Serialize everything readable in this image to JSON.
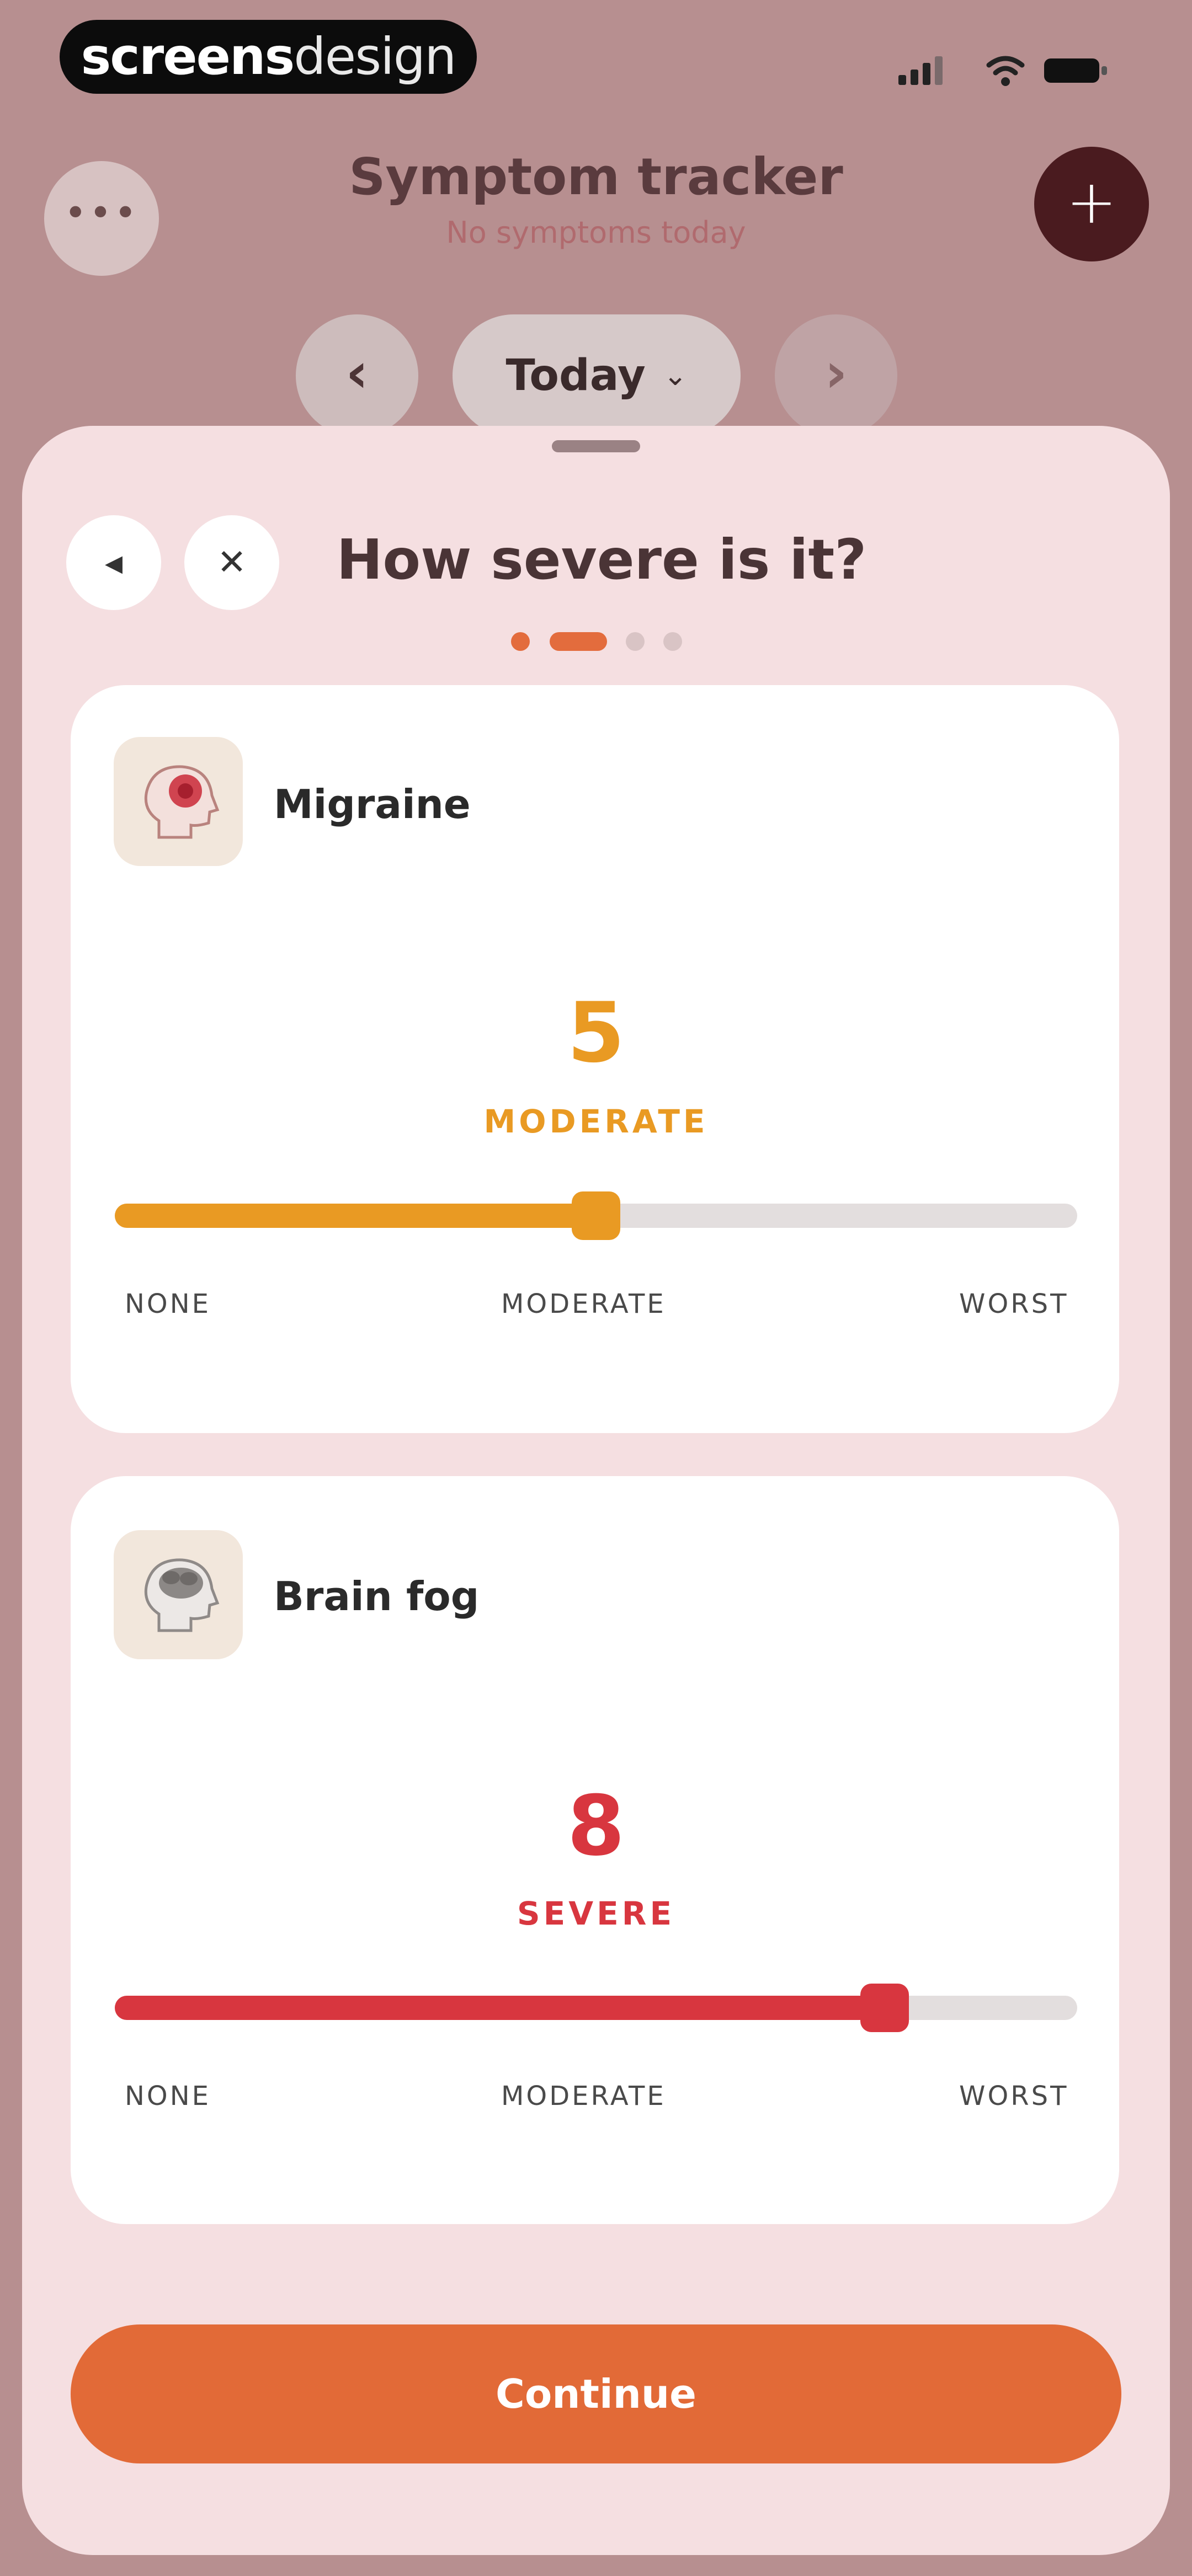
{
  "status_bar": {
    "brand_bold": "screens",
    "brand_light": "design",
    "icons": [
      "cellular-signal-icon",
      "wifi-icon",
      "battery-icon"
    ]
  },
  "header": {
    "title": "Symptom tracker",
    "subtitle": "No symptoms today",
    "more_icon": "more-icon",
    "add_icon": "plus-icon"
  },
  "date_nav": {
    "label": "Today",
    "prev_icon": "chevron-left-icon",
    "next_icon": "chevron-right-icon",
    "caret_icon": "chevron-down-icon"
  },
  "sheet": {
    "title": "How severe is it?",
    "back_icon": "back-icon",
    "close_icon": "close-icon",
    "steps_total": 4,
    "step_current": 2
  },
  "symptoms": [
    {
      "name": "Migraine",
      "icon": "migraine-head-icon",
      "value": "5",
      "level": "MODERATE",
      "fraction": 0.5,
      "color": "#e99a23",
      "scale": {
        "min": "NONE",
        "mid": "MODERATE",
        "max": "WORST"
      }
    },
    {
      "name": "Brain fog",
      "icon": "brain-fog-head-icon",
      "value": "8",
      "level": "SEVERE",
      "fraction": 0.8,
      "color": "#d8363f",
      "scale": {
        "min": "NONE",
        "mid": "MODERATE",
        "max": "WORST"
      }
    }
  ],
  "continue_label": "Continue",
  "colors": {
    "background": "#b78f90",
    "sheet": "#f5dfe1",
    "accent": "#e26a37",
    "moderate": "#e99a23",
    "severe": "#d8363f"
  }
}
